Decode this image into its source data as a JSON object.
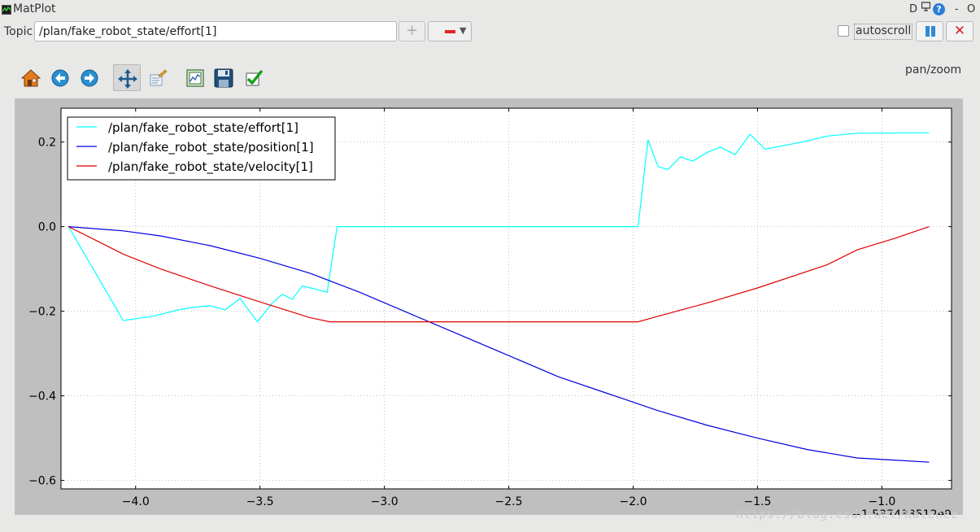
{
  "window": {
    "title": "MatPlot",
    "controls": [
      "D",
      "-",
      "O"
    ],
    "help_label": "?"
  },
  "topic_bar": {
    "label": "Topic",
    "input_value": "/plan/fake_robot_state/effort[1]",
    "add_label": "+",
    "autoscroll_label": "autoscroll",
    "autoscroll_checked": false,
    "clear_label": "✕"
  },
  "toolbar": {
    "icons": [
      "home-icon",
      "back-icon",
      "forward-icon",
      "pan-icon",
      "subplots-icon",
      "zoom-rect-icon",
      "save-icon",
      "check-icon"
    ],
    "mode_label": "pan/zoom"
  },
  "watermark": "https://blog.csdn.net/Kalenee",
  "chart_data": {
    "type": "line",
    "xlim": [
      -4.3,
      -0.72
    ],
    "ylim": [
      -0.62,
      0.28
    ],
    "x_ticks": [
      -4.0,
      -3.5,
      -3.0,
      -2.5,
      -2.0,
      -1.5,
      -1.0
    ],
    "x_tick_labels": [
      "−4.0",
      "−3.5",
      "−3.0",
      "−2.5",
      "−2.0",
      "−1.5",
      "−1.0"
    ],
    "y_ticks": [
      0.2,
      0.0,
      -0.2,
      -0.4,
      -0.6
    ],
    "y_tick_labels": [
      "0.2",
      "0.0",
      "−0.2",
      "−0.4",
      "−0.6"
    ],
    "x_offset_label": "−1.537433512e9",
    "grid": true,
    "legend_position": "top-left",
    "series": [
      {
        "name": "/plan/fake_robot_state/effort[1]",
        "color": "#00ffff",
        "points": [
          [
            -4.27,
            0.0
          ],
          [
            -4.05,
            -0.222
          ],
          [
            -3.93,
            -0.212
          ],
          [
            -3.83,
            -0.197
          ],
          [
            -3.77,
            -0.191
          ],
          [
            -3.7,
            -0.187
          ],
          [
            -3.64,
            -0.197
          ],
          [
            -3.58,
            -0.17
          ],
          [
            -3.51,
            -0.225
          ],
          [
            -3.45,
            -0.18
          ],
          [
            -3.41,
            -0.16
          ],
          [
            -3.37,
            -0.172
          ],
          [
            -3.33,
            -0.14
          ],
          [
            -3.23,
            -0.155
          ],
          [
            -3.19,
            0.0
          ],
          [
            -1.98,
            0.0
          ],
          [
            -1.94,
            0.205
          ],
          [
            -1.9,
            0.142
          ],
          [
            -1.86,
            0.135
          ],
          [
            -1.81,
            0.165
          ],
          [
            -1.76,
            0.155
          ],
          [
            -1.7,
            0.176
          ],
          [
            -1.65,
            0.188
          ],
          [
            -1.59,
            0.17
          ],
          [
            -1.53,
            0.218
          ],
          [
            -1.47,
            0.183
          ],
          [
            -1.32,
            0.2
          ],
          [
            -1.22,
            0.214
          ],
          [
            -1.1,
            0.221
          ],
          [
            -0.81,
            0.222
          ]
        ]
      },
      {
        "name": "/plan/fake_robot_state/position[1]",
        "color": "#0000e0",
        "points": [
          [
            -4.27,
            0.0
          ],
          [
            -4.05,
            -0.01
          ],
          [
            -3.9,
            -0.022
          ],
          [
            -3.7,
            -0.045
          ],
          [
            -3.5,
            -0.075
          ],
          [
            -3.3,
            -0.11
          ],
          [
            -3.1,
            -0.155
          ],
          [
            -2.9,
            -0.205
          ],
          [
            -2.7,
            -0.255
          ],
          [
            -2.5,
            -0.305
          ],
          [
            -2.3,
            -0.355
          ],
          [
            -2.1,
            -0.395
          ],
          [
            -1.9,
            -0.435
          ],
          [
            -1.7,
            -0.47
          ],
          [
            -1.5,
            -0.5
          ],
          [
            -1.3,
            -0.527
          ],
          [
            -1.1,
            -0.547
          ],
          [
            -0.95,
            -0.552
          ],
          [
            -0.81,
            -0.557
          ]
        ]
      },
      {
        "name": "/plan/fake_robot_state/velocity[1]",
        "color": "#e00000",
        "points": [
          [
            -4.27,
            0.0
          ],
          [
            -4.05,
            -0.065
          ],
          [
            -3.9,
            -0.1
          ],
          [
            -3.7,
            -0.14
          ],
          [
            -3.5,
            -0.178
          ],
          [
            -3.3,
            -0.215
          ],
          [
            -3.22,
            -0.225
          ],
          [
            -1.98,
            -0.225
          ],
          [
            -1.92,
            -0.215
          ],
          [
            -1.7,
            -0.18
          ],
          [
            -1.5,
            -0.145
          ],
          [
            -1.22,
            -0.09
          ],
          [
            -1.1,
            -0.055
          ],
          [
            -0.95,
            -0.028
          ],
          [
            -0.81,
            0.0
          ]
        ]
      }
    ]
  }
}
